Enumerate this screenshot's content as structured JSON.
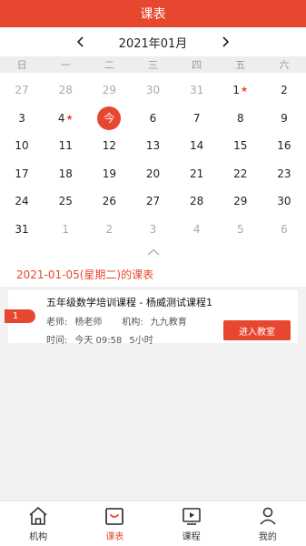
{
  "header": {
    "title": "课表"
  },
  "month": {
    "title": "2021年01月"
  },
  "weekdays": [
    "日",
    "一",
    "二",
    "三",
    "四",
    "五",
    "六"
  ],
  "calendar": [
    {
      "d": "27",
      "muted": true
    },
    {
      "d": "28",
      "muted": true
    },
    {
      "d": "29",
      "muted": true
    },
    {
      "d": "30",
      "muted": true
    },
    {
      "d": "31",
      "muted": true
    },
    {
      "d": "1",
      "star": true
    },
    {
      "d": "2"
    },
    {
      "d": "3"
    },
    {
      "d": "4",
      "star": true
    },
    {
      "d": "今",
      "today": true
    },
    {
      "d": "6"
    },
    {
      "d": "7"
    },
    {
      "d": "8"
    },
    {
      "d": "9"
    },
    {
      "d": "10"
    },
    {
      "d": "11"
    },
    {
      "d": "12"
    },
    {
      "d": "13"
    },
    {
      "d": "14"
    },
    {
      "d": "15"
    },
    {
      "d": "16"
    },
    {
      "d": "17"
    },
    {
      "d": "18"
    },
    {
      "d": "19"
    },
    {
      "d": "20"
    },
    {
      "d": "21"
    },
    {
      "d": "22"
    },
    {
      "d": "23"
    },
    {
      "d": "24"
    },
    {
      "d": "25"
    },
    {
      "d": "26"
    },
    {
      "d": "27"
    },
    {
      "d": "28"
    },
    {
      "d": "29"
    },
    {
      "d": "30"
    },
    {
      "d": "31"
    },
    {
      "d": "1",
      "muted": true
    },
    {
      "d": "2",
      "muted": true
    },
    {
      "d": "3",
      "muted": true
    },
    {
      "d": "4",
      "muted": true
    },
    {
      "d": "5",
      "muted": true
    },
    {
      "d": "6",
      "muted": true
    }
  ],
  "selected": {
    "title": "2021-01-05(星期二)的课表"
  },
  "course": {
    "index": "1",
    "title": "五年级数学培训课程 - 杨威测试课程1",
    "teacher_label": "老师:",
    "teacher": "杨老师",
    "org_label": "机构:",
    "org": "九九教育",
    "time_label": "时间:",
    "time": "今天 09:58",
    "duration": "5小时",
    "enter_label": "进入教室"
  },
  "tabs": [
    {
      "label": "机构",
      "icon": "home-icon"
    },
    {
      "label": "课表",
      "icon": "calendar-icon",
      "active": true
    },
    {
      "label": "课程",
      "icon": "play-icon"
    },
    {
      "label": "我的",
      "icon": "user-icon"
    }
  ],
  "colors": {
    "accent": "#e8472f"
  }
}
